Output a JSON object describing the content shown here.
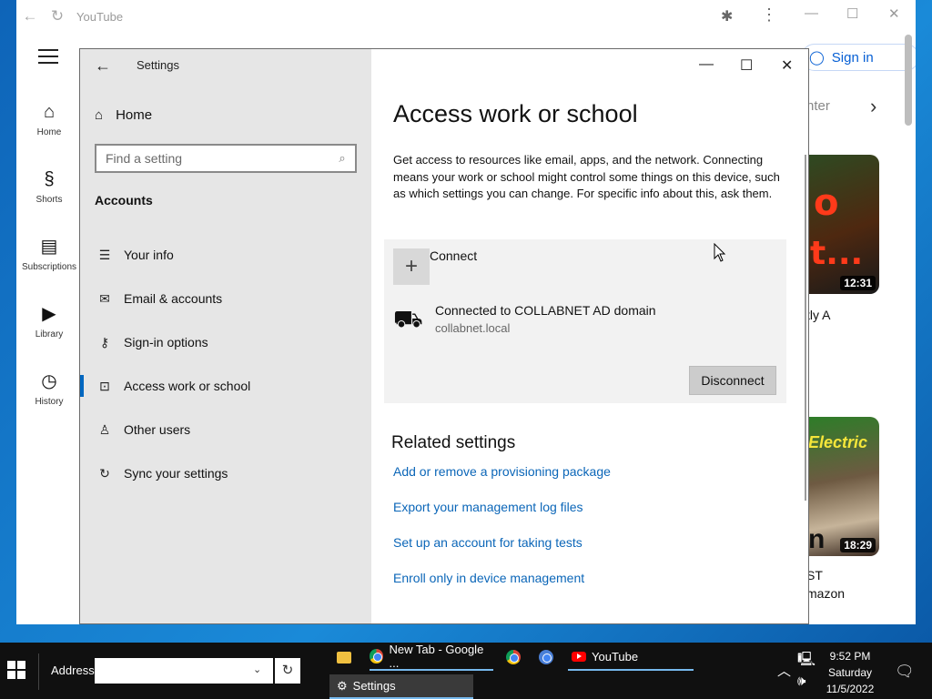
{
  "chrome": {
    "tab_title": "YouTube",
    "signin_label": "Sign in",
    "chip_text": "nter",
    "sidebar": [
      {
        "label": "Home",
        "icon": "home-icon"
      },
      {
        "label": "Shorts",
        "icon": "shorts-icon"
      },
      {
        "label": "Subscriptions",
        "icon": "subscriptions-icon"
      },
      {
        "label": "Library",
        "icon": "library-icon"
      },
      {
        "label": "History",
        "icon": "history-icon"
      }
    ],
    "videos": [
      {
        "duration": "12:31",
        "title_line1": "tly A",
        "title_line2": ""
      },
      {
        "duration": "18:29",
        "title_line1": "ST",
        "title_line2": "mazon"
      }
    ]
  },
  "settings": {
    "app_title": "Settings",
    "home_label": "Home",
    "search_placeholder": "Find a setting",
    "section_label": "Accounts",
    "nav_items": [
      {
        "label": "Your info",
        "icon": "person-icon"
      },
      {
        "label": "Email & accounts",
        "icon": "mail-icon"
      },
      {
        "label": "Sign-in options",
        "icon": "key-icon"
      },
      {
        "label": "Access work or school",
        "icon": "briefcase-icon",
        "active": true
      },
      {
        "label": "Other users",
        "icon": "add-person-icon"
      },
      {
        "label": "Sync your settings",
        "icon": "sync-icon"
      }
    ],
    "heading": "Access work or school",
    "description": "Get access to resources like email, apps, and the network. Connecting means your work or school might control some things on this device, such as which settings you can change. For specific info about this, ask them.",
    "connect_label": "Connect",
    "domain_title": "Connected to COLLABNET AD domain",
    "domain_sub": "collabnet.local",
    "disconnect_label": "Disconnect",
    "related_heading": "Related settings",
    "related_links": [
      "Add or remove a provisioning package",
      "Export your management log files",
      "Set up an account for taking tests",
      "Enroll only in device management"
    ]
  },
  "taskbar": {
    "address_label": "Address",
    "address_value": "",
    "buttons": [
      "New Tab - Google ...",
      "YouTube"
    ],
    "settings_button": "Settings",
    "time": "9:52 PM",
    "day": "Saturday",
    "date": "11/5/2022"
  },
  "colors": {
    "accent": "#0067c0",
    "link": "#0b66b8",
    "youtube_red": "#ff0000",
    "youtube_blue": "#065fd4"
  }
}
